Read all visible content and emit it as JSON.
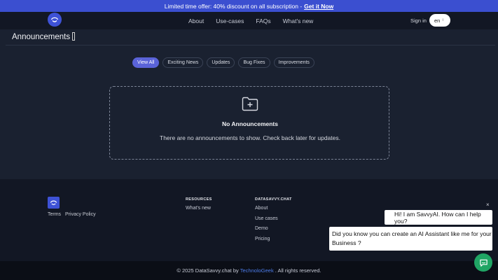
{
  "promo": {
    "text": "Limited time offer: 40% discount on all subscription -",
    "link": "Get it Now"
  },
  "nav": {
    "links": [
      "About",
      "Use-cases",
      "FAQs",
      "What's new"
    ],
    "signin": "Sign in",
    "language": "en"
  },
  "page": {
    "title": "Announcements"
  },
  "filters": [
    "View All",
    "Exciting News",
    "Updates",
    "Bug Fixes",
    "Improvements"
  ],
  "active_filter": "View All",
  "empty_state": {
    "title": "No Announcements",
    "message": "There are no announcements to show. Check back later for updates."
  },
  "footer": {
    "links": [
      "Terms",
      "Privacy Policy"
    ],
    "resources": {
      "heading": "RESOURCES",
      "items": [
        "What's new"
      ]
    },
    "datasavvy": {
      "heading": "DATASAVVY.CHAT",
      "items": [
        "About",
        "Use cases",
        "Demo",
        "Pricing"
      ]
    },
    "copyright_prefix": "© 2025 DataSavvy.chat by",
    "copyright_brand": "TechnoloGeek",
    "copyright_suffix": ". All rights reserved."
  },
  "chat": {
    "close": "×",
    "greeting": "Hi! I am SavvyAI. How can I help you?",
    "message": "Did you know you can create an AI Assistant like me for your Business ?"
  },
  "colors": {
    "accent": "#3e52d6",
    "active_chip": "#5a63d8",
    "chat": "#20a564",
    "brand_link": "#4d7ce8"
  }
}
